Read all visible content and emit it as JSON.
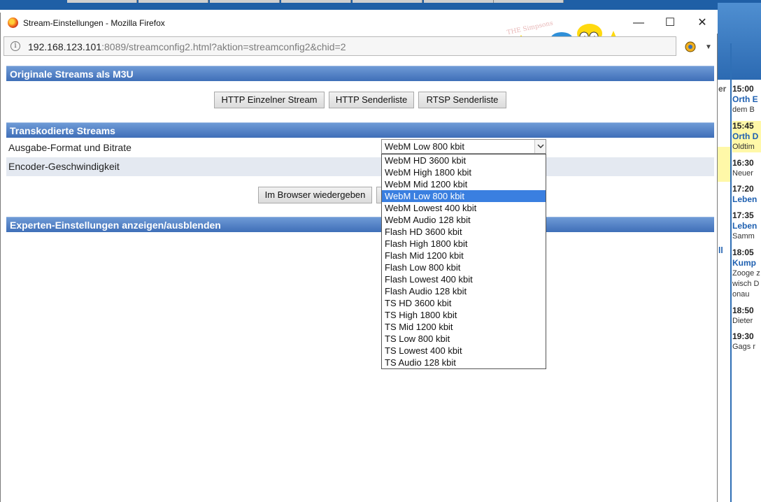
{
  "window": {
    "title": "Stream-Einstellungen - Mozilla Firefox",
    "minimize": "—",
    "maximize": "☐",
    "close": "✕"
  },
  "urlbar": {
    "host": "192.168.123.101",
    "rest": ":8089/streamconfig2.html?aktion=streamconfig2&chid=2"
  },
  "sections": {
    "originals": "Originale Streams als M3U",
    "transcoded": "Transkodierte Streams",
    "experts": "Experten-Einstellungen anzeigen/ausblenden"
  },
  "buttons": {
    "http_single": "HTTP Einzelner Stream",
    "http_list": "HTTP Senderliste",
    "rtsp_list": "RTSP Senderliste",
    "play_browser": "Im Browser wiedergeben"
  },
  "rows": {
    "format_label": "Ausgabe-Format und Bitrate",
    "speed_label": "Encoder-Geschwindigkeit"
  },
  "select": {
    "value": "WebM Low 800 kbit",
    "selected_index": 3,
    "options": [
      "WebM HD 3600 kbit",
      "WebM High 1800 kbit",
      "WebM Mid 1200 kbit",
      "WebM Low 800 kbit",
      "WebM Lowest 400 kbit",
      "WebM Audio 128 kbit",
      "Flash HD 3600 kbit",
      "Flash High 1800 kbit",
      "Flash Mid 1200 kbit",
      "Flash Low 800 kbit",
      "Flash Lowest 400 kbit",
      "Flash Audio 128 kbit",
      "TS HD 3600 kbit",
      "TS High 1800 kbit",
      "TS Mid 1200 kbit",
      "TS Low 800 kbit",
      "TS Lowest 400 kbit",
      "TS Audio 128 kbit"
    ]
  },
  "background": {
    "side_text_1": "er",
    "side_text_2": "ll",
    "epg": [
      {
        "time": "15:00",
        "title": "Orth E",
        "desc": "dem B",
        "highlight": false
      },
      {
        "time": "15:45",
        "title": "Orth D",
        "desc": "Oldtim",
        "highlight": true
      },
      {
        "time": "16:30",
        "title": "",
        "desc": "Neuer",
        "highlight": false
      },
      {
        "time": "17:20",
        "title": "Leben",
        "desc": "",
        "highlight": false
      },
      {
        "time": "17:35",
        "title": "Leben",
        "desc": "Samm",
        "highlight": false
      },
      {
        "time": "18:05",
        "title": "Kump",
        "desc": "Zooge zwisch Donau",
        "highlight": false
      },
      {
        "time": "18:50",
        "title": "",
        "desc": "Dieter",
        "highlight": false
      },
      {
        "time": "19:30",
        "title": "",
        "desc": "Gags r",
        "highlight": false
      }
    ]
  },
  "colors": {
    "header_blue": "#3f6fb8",
    "selection_blue": "#3a7fe0",
    "row_alt": "#e4e9f1",
    "epg_highlight": "#fff8a8"
  }
}
